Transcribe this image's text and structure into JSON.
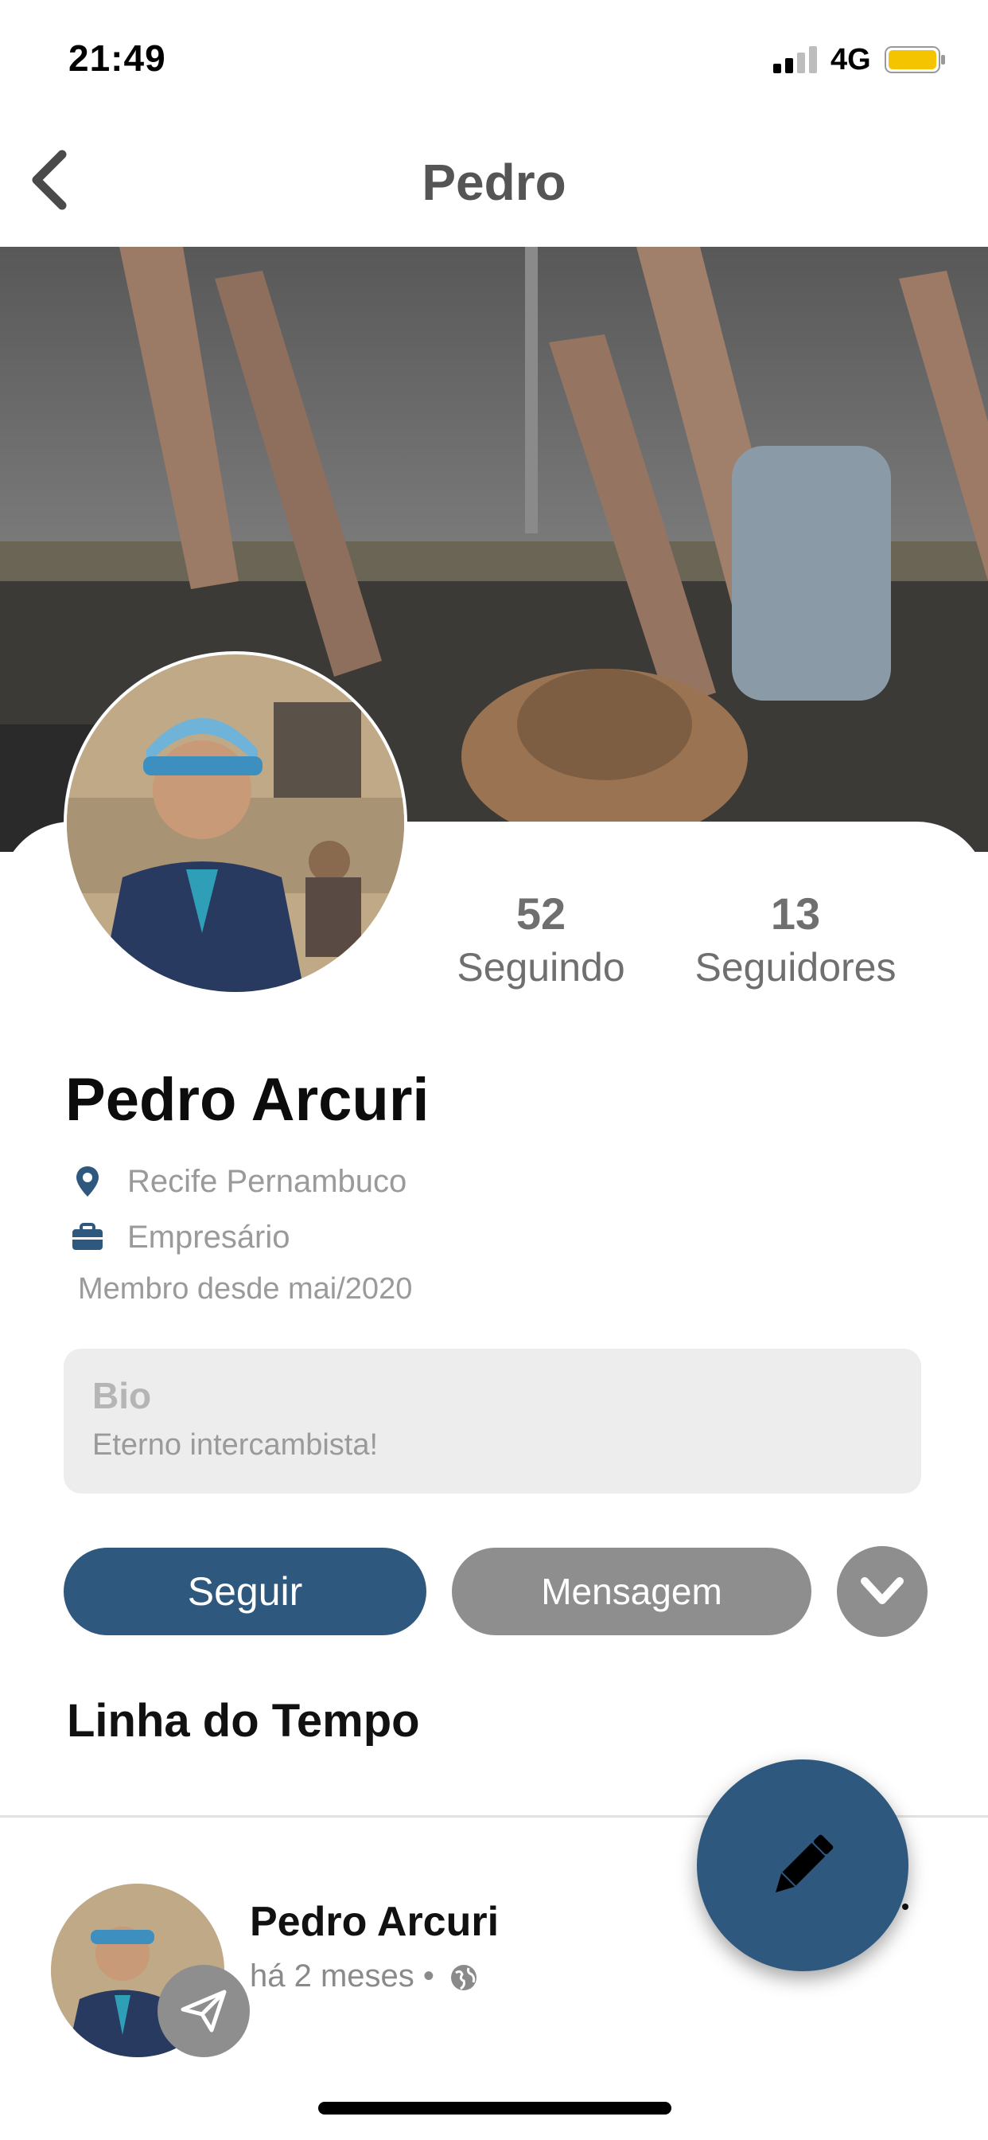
{
  "status_bar": {
    "time": "21:49",
    "network": "4G"
  },
  "nav": {
    "title": "Pedro"
  },
  "profile": {
    "following_count": "52",
    "following_label": "Seguindo",
    "followers_count": "13",
    "followers_label": "Seguidores",
    "name": "Pedro Arcuri",
    "location": "Recife Pernambuco",
    "occupation": "Empresário",
    "member_since": "Membro desde mai/2020"
  },
  "bio": {
    "title": "Bio",
    "text": "Eterno intercambista!"
  },
  "actions": {
    "follow_label": "Seguir",
    "message_label": "Mensagem"
  },
  "timeline": {
    "title": "Linha do Tempo",
    "posts": [
      {
        "author": "Pedro Arcuri",
        "time": "há 2 meses •"
      }
    ]
  },
  "colors": {
    "primary": "#2f587f",
    "secondary_button": "#8e8e8e",
    "bio_bg": "#ededed",
    "battery": "#f5c400"
  },
  "icons": [
    "back-chevron-icon",
    "location-pin-icon",
    "briefcase-icon",
    "chevron-down-icon",
    "paper-plane-icon",
    "globe-icon",
    "pencil-icon",
    "more-dots-icon"
  ]
}
